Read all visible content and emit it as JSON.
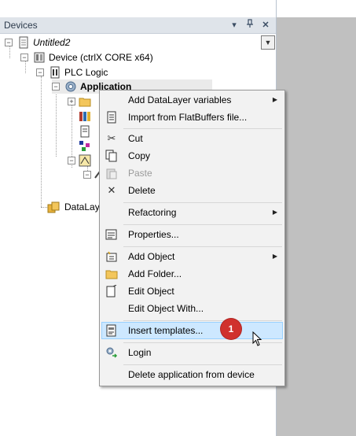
{
  "panel": {
    "title": "Devices",
    "pin_glyph": "▾",
    "dock_glyph": "⸸",
    "close_glyph": "✕"
  },
  "tree": {
    "root": "Untitled2",
    "device": "Device (ctrlX CORE x64)",
    "plc_logic": "PLC Logic",
    "application": "Application",
    "datalayer": "DataLaye"
  },
  "context_menu": {
    "items": [
      {
        "label": "Add DataLayer variables",
        "icon": "none",
        "submenu": true
      },
      {
        "label": "Import from FlatBuffers file...",
        "icon": "document-icon"
      },
      {
        "label": "Cut",
        "icon": "scissors-icon"
      },
      {
        "label": "Copy",
        "icon": "copy-icon"
      },
      {
        "label": "Paste",
        "icon": "paste-icon",
        "disabled": true
      },
      {
        "label": "Delete",
        "icon": "delete-icon"
      },
      {
        "label": "Refactoring",
        "icon": "none",
        "submenu": true
      },
      {
        "label": "Properties...",
        "icon": "properties-icon"
      },
      {
        "label": "Add Object",
        "icon": "add-object-icon",
        "submenu": true
      },
      {
        "label": "Add Folder...",
        "icon": "folder-icon"
      },
      {
        "label": "Edit Object",
        "icon": "edit-object-icon"
      },
      {
        "label": "Edit Object With...",
        "icon": "none"
      },
      {
        "label": "Insert templates...",
        "icon": "templates-icon",
        "highlighted": true
      },
      {
        "label": "Login",
        "icon": "login-icon"
      },
      {
        "label": "Delete application from device",
        "icon": "none"
      }
    ],
    "arrow_glyph": "▶"
  },
  "badge": {
    "text": "1",
    "color": "#d0312d"
  },
  "colors": {
    "highlight": "#cde8ff",
    "gray_area": "#c0c0c0"
  }
}
